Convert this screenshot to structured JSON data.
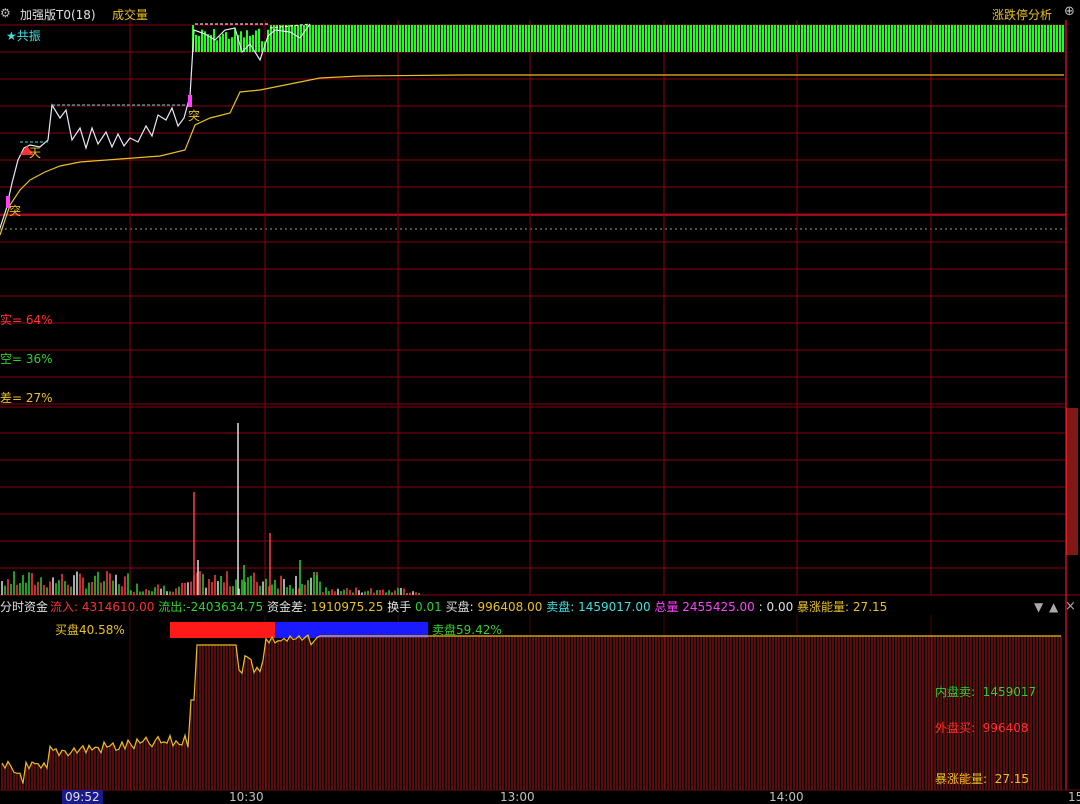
{
  "top_header": {
    "left_icon": "chart-settings-icon",
    "title": "加强版T0(18)",
    "subtitle": "成交量",
    "right_label": "涨跌停分析",
    "corner_icon": "plus-circle-icon"
  },
  "price_panel": {
    "legend": "★共振",
    "markers": {
      "tu1": "突",
      "tu2": "突",
      "tu3": "突",
      "tianlian": "天"
    },
    "stats": [
      "实= 64%",
      "空= 36%",
      "差= 27%"
    ]
  },
  "fund_panel": {
    "title": "分时资金",
    "inflow_label": "流入:",
    "inflow_value": "4314610.00",
    "outflow_label": "流出:",
    "outflow_value": "-2403634.75",
    "diff_label": "资金差:",
    "diff_value": "1910975.25",
    "turnover_label": "换手",
    "turnover_value": "0.01",
    "buy_label": "买盘:",
    "buy_value": "996408.00",
    "sell_label": "卖盘:",
    "sell_value": "1459017.00",
    "total_label": "总量",
    "total_value": "2455425.00",
    "extra": ": 0.00",
    "surge_label": "暴涨能量:",
    "surge_value": "27.15",
    "buy_ratio_label": "买盘40.58%",
    "sell_ratio_label": "卖盘59.42%",
    "buy_ratio": 0.4058,
    "sell_ratio": 0.5942,
    "inner_label": "内盘卖:",
    "inner_value": "1459017",
    "outer_label": "外盘买:",
    "outer_value": "996408",
    "surge2_label": "暴涨能量:",
    "surge2_value": "27.15",
    "ctl_down": "▼",
    "ctl_up": "▲",
    "ctl_close": "×"
  },
  "time_axis": {
    "current": "09:52",
    "t1030": "10:30",
    "t1300": "13:00",
    "t1400": "14:00",
    "t1500": "15"
  },
  "colors": {
    "grid": "#8b0012",
    "red": "#ff3030",
    "green": "#30d030",
    "yellow": "#e8c020",
    "cyan": "#40e0e0",
    "blue": "#1a1aff",
    "magenta": "#ff40ff",
    "white": "#e0e0e0"
  }
}
